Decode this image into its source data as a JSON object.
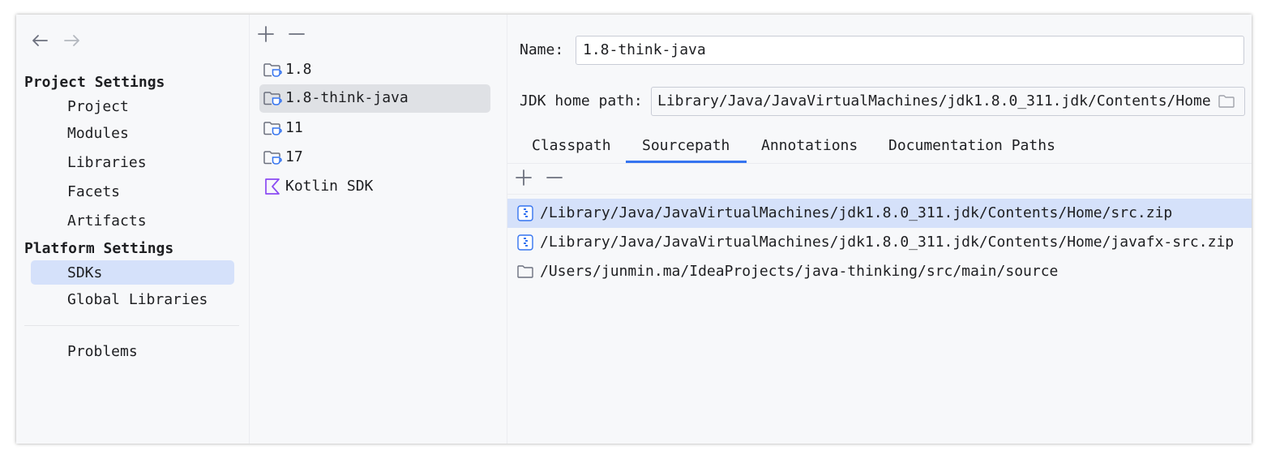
{
  "nav": {
    "back_icon": "arrow-left-icon",
    "forward_icon": "arrow-right-icon"
  },
  "sidebar": {
    "project_settings_heading": "Project Settings",
    "project_items": [
      {
        "label": "Project"
      },
      {
        "label": "Modules"
      },
      {
        "label": "Libraries"
      },
      {
        "label": "Facets"
      },
      {
        "label": "Artifacts"
      }
    ],
    "platform_settings_heading": "Platform Settings",
    "platform_items": [
      {
        "label": "SDKs",
        "selected": true
      },
      {
        "label": "Global Libraries"
      }
    ],
    "problems_label": "Problems"
  },
  "sdk_list": {
    "add_icon": "plus-icon",
    "remove_icon": "minus-icon",
    "items": [
      {
        "label": "1.8",
        "icon": "jdk-folder-icon"
      },
      {
        "label": "1.8-think-java",
        "icon": "jdk-folder-icon",
        "selected": true
      },
      {
        "label": "11",
        "icon": "jdk-folder-icon"
      },
      {
        "label": "17",
        "icon": "jdk-folder-icon"
      },
      {
        "label": "Kotlin SDK",
        "icon": "kotlin-icon"
      }
    ]
  },
  "details": {
    "name_label": "Name:",
    "name_value": "1.8-think-java",
    "jdk_home_label": "JDK home path:",
    "jdk_home_value": "Library/Java/JavaVirtualMachines/jdk1.8.0_311.jdk/Contents/Home",
    "browse_icon": "folder-icon",
    "tabs": [
      {
        "label": "Classpath"
      },
      {
        "label": "Sourcepath",
        "active": true
      },
      {
        "label": "Annotations"
      },
      {
        "label": "Documentation Paths"
      }
    ],
    "paths": [
      {
        "path": "/Library/Java/JavaVirtualMachines/jdk1.8.0_311.jdk/Contents/Home/src.zip",
        "icon": "archive-icon",
        "selected": true
      },
      {
        "path": "/Library/Java/JavaVirtualMachines/jdk1.8.0_311.jdk/Contents/Home/javafx-src.zip",
        "icon": "archive-icon"
      },
      {
        "path": "/Users/junmin.ma/IdeaProjects/java-thinking/src/main/source",
        "icon": "folder-icon"
      }
    ]
  },
  "colors": {
    "accent": "#3574f0",
    "selection": "#d5e1fa",
    "background": "#f7f8fa"
  }
}
